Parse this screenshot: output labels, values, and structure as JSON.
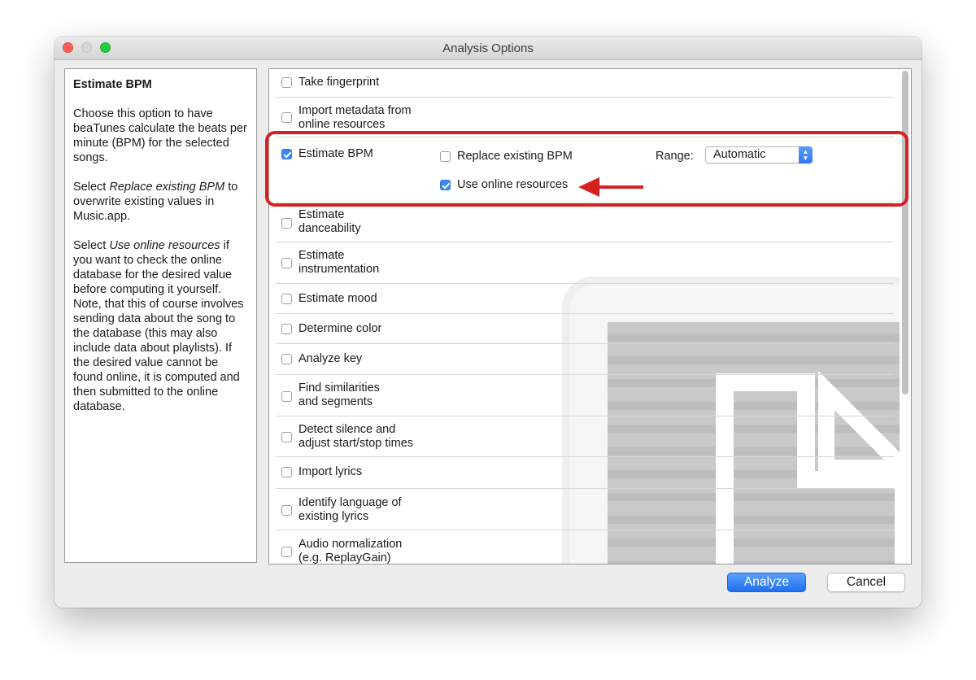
{
  "window": {
    "title": "Analysis Options"
  },
  "help": {
    "title": "Estimate BPM",
    "para1": "Choose this option to have beaTunes calculate the beats per minute (BPM) for the selected songs.",
    "para2_prefix": "Select ",
    "para2_em": "Replace existing BPM",
    "para2_suffix": " to overwrite existing values in Music.app.",
    "para3_prefix": "Select ",
    "para3_em": "Use online resources",
    "para3_suffix": " if you want to check the online database for the desired value before computing it yourself. Note, that this of course involves sending data about the song to the database (this may also include data about playlists). If the desired value cannot be found online, it is computed and then submitted to the online database."
  },
  "options": [
    {
      "label1": "Take fingerprint",
      "label2": "",
      "checked": false
    },
    {
      "label1": "Import metadata from",
      "label2": "online resources",
      "checked": false
    },
    {
      "label1": "Estimate BPM",
      "label2": "",
      "checked": true
    },
    {
      "label1": "Estimate",
      "label2": "danceability",
      "checked": false
    },
    {
      "label1": "Estimate",
      "label2": "instrumentation",
      "checked": false
    },
    {
      "label1": "Estimate mood",
      "label2": "",
      "checked": false
    },
    {
      "label1": "Determine color",
      "label2": "",
      "checked": false
    },
    {
      "label1": "Analyze key",
      "label2": "",
      "checked": false
    },
    {
      "label1": "Find similarities",
      "label2": "and segments",
      "checked": false
    },
    {
      "label1": "Detect silence and",
      "label2": "adjust start/stop times",
      "checked": false
    },
    {
      "label1": "Import lyrics",
      "label2": "",
      "checked": false
    },
    {
      "label1": "Identify language of",
      "label2": "existing lyrics",
      "checked": false
    },
    {
      "label1": "Audio normalization",
      "label2": "(e.g. ReplayGain)",
      "checked": false
    }
  ],
  "bpm_options": {
    "replace_label": "Replace existing BPM",
    "replace_checked": false,
    "online_label": "Use online resources",
    "online_checked": true,
    "range_label": "Range:",
    "range_value": "Automatic"
  },
  "buttons": {
    "analyze": "Analyze",
    "cancel": "Cancel"
  },
  "colors": {
    "accent": "#3b88f5",
    "highlight": "#d62121"
  }
}
